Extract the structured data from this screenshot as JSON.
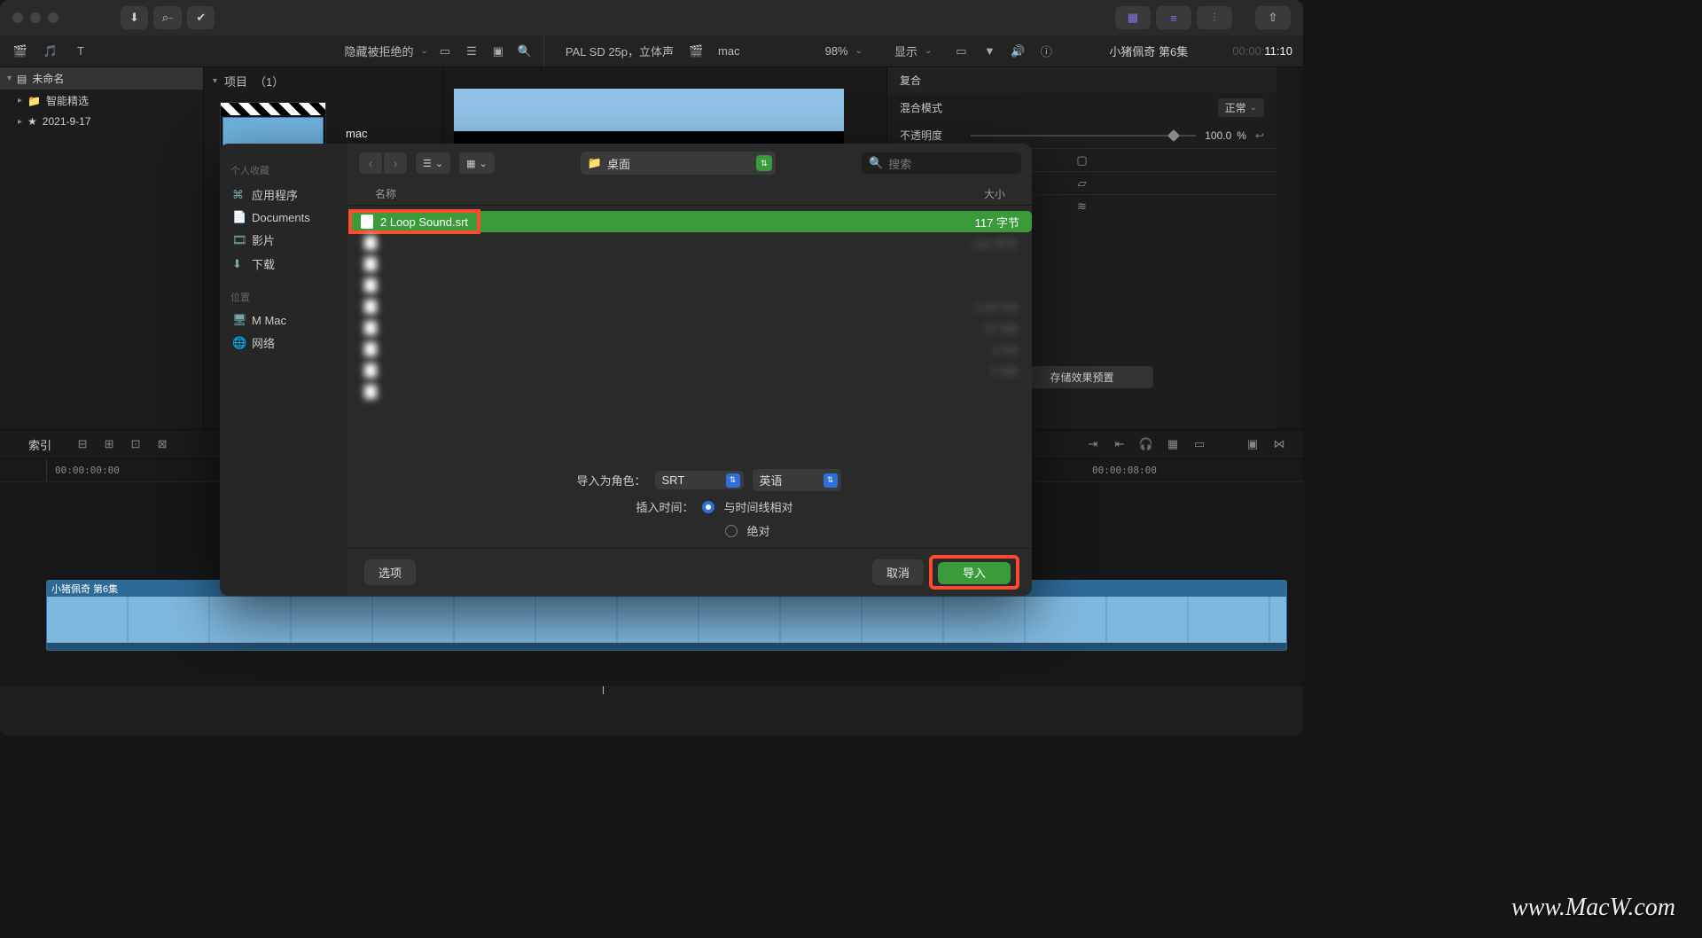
{
  "toolbar": {
    "hide_rejected": "隐藏被拒绝的",
    "toggles": [
      "⬇",
      "⌕⎯",
      "✓"
    ]
  },
  "browser": {
    "lib_name": "未命名",
    "folders": [
      "智能精选",
      "2021-9-17"
    ],
    "projects_label": "项目",
    "projects_count": "（1）",
    "clip_name": "mac"
  },
  "viewer": {
    "format": "PAL SD 25p，立体声",
    "clip": "mac",
    "zoom": "98%",
    "view_label": "显示"
  },
  "inspector": {
    "title": "小猪佩奇 第6集",
    "timecode_dim": "00:00:",
    "timecode": "11:10",
    "section": "复合",
    "blend_label": "混合模式",
    "blend_value": "正常",
    "opacity_label": "不透明度",
    "opacity_value": "100.0",
    "opacity_unit": "%",
    "save_preset": "存储效果预置"
  },
  "timeline": {
    "index_label": "索引",
    "t0": "00:00:00:00",
    "t1": "00:00:08:00",
    "clip_title": "小猪佩奇 第6集"
  },
  "dialog": {
    "sidebar": {
      "favorites_hdr": "个人收藏",
      "favorites": [
        "应用程序",
        "Documents",
        "影片",
        "下载"
      ],
      "locations_hdr": "位置",
      "locations": [
        "M             Mac",
        "网络"
      ]
    },
    "location": "桌面",
    "search_placeholder": "搜索",
    "columns": {
      "name": "名称",
      "size": "大小"
    },
    "rows": [
      {
        "name": "2 Loop Sound.srt",
        "size": "117 字节",
        "selected": true
      },
      {
        "name": "",
        "size": "109 字节"
      },
      {
        "name": "",
        "size": "--"
      },
      {
        "name": "",
        "size": "--"
      },
      {
        "name": "",
        "size": "2.93 GB"
      },
      {
        "name": "",
        "size": "42 MB"
      },
      {
        "name": "",
        "size": "1 KB"
      },
      {
        "name": "",
        "size": "4 MB"
      },
      {
        "name": "",
        "size": "--"
      }
    ],
    "role_label": "导入为角色：",
    "role_value": "SRT",
    "lang_value": "英语",
    "insert_label": "插入时间：",
    "insert_opt1": "与时间线相对",
    "insert_opt2": "绝对",
    "options_btn": "选项",
    "cancel": "取消",
    "import": "导入"
  },
  "watermark": "www.MacW.com"
}
